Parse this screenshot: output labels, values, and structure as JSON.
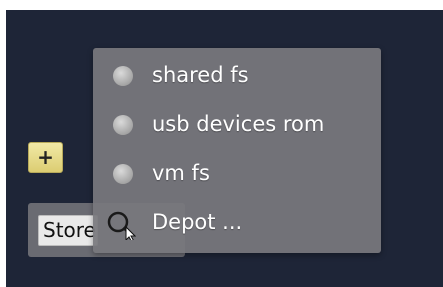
{
  "toolbar": {
    "add_label": "+",
    "store_label": "Store"
  },
  "menu": {
    "items": [
      {
        "label": "shared fs",
        "icon": "radio-icon"
      },
      {
        "label": "usb devices rom",
        "icon": "radio-icon"
      },
      {
        "label": "vm fs",
        "icon": "radio-icon"
      },
      {
        "label": "Depot ...",
        "icon": "search-icon"
      }
    ]
  },
  "colors": {
    "background": "#1e2537",
    "menu": "#78787d",
    "add_button": "#e8de8f",
    "text": "#ffffff"
  }
}
